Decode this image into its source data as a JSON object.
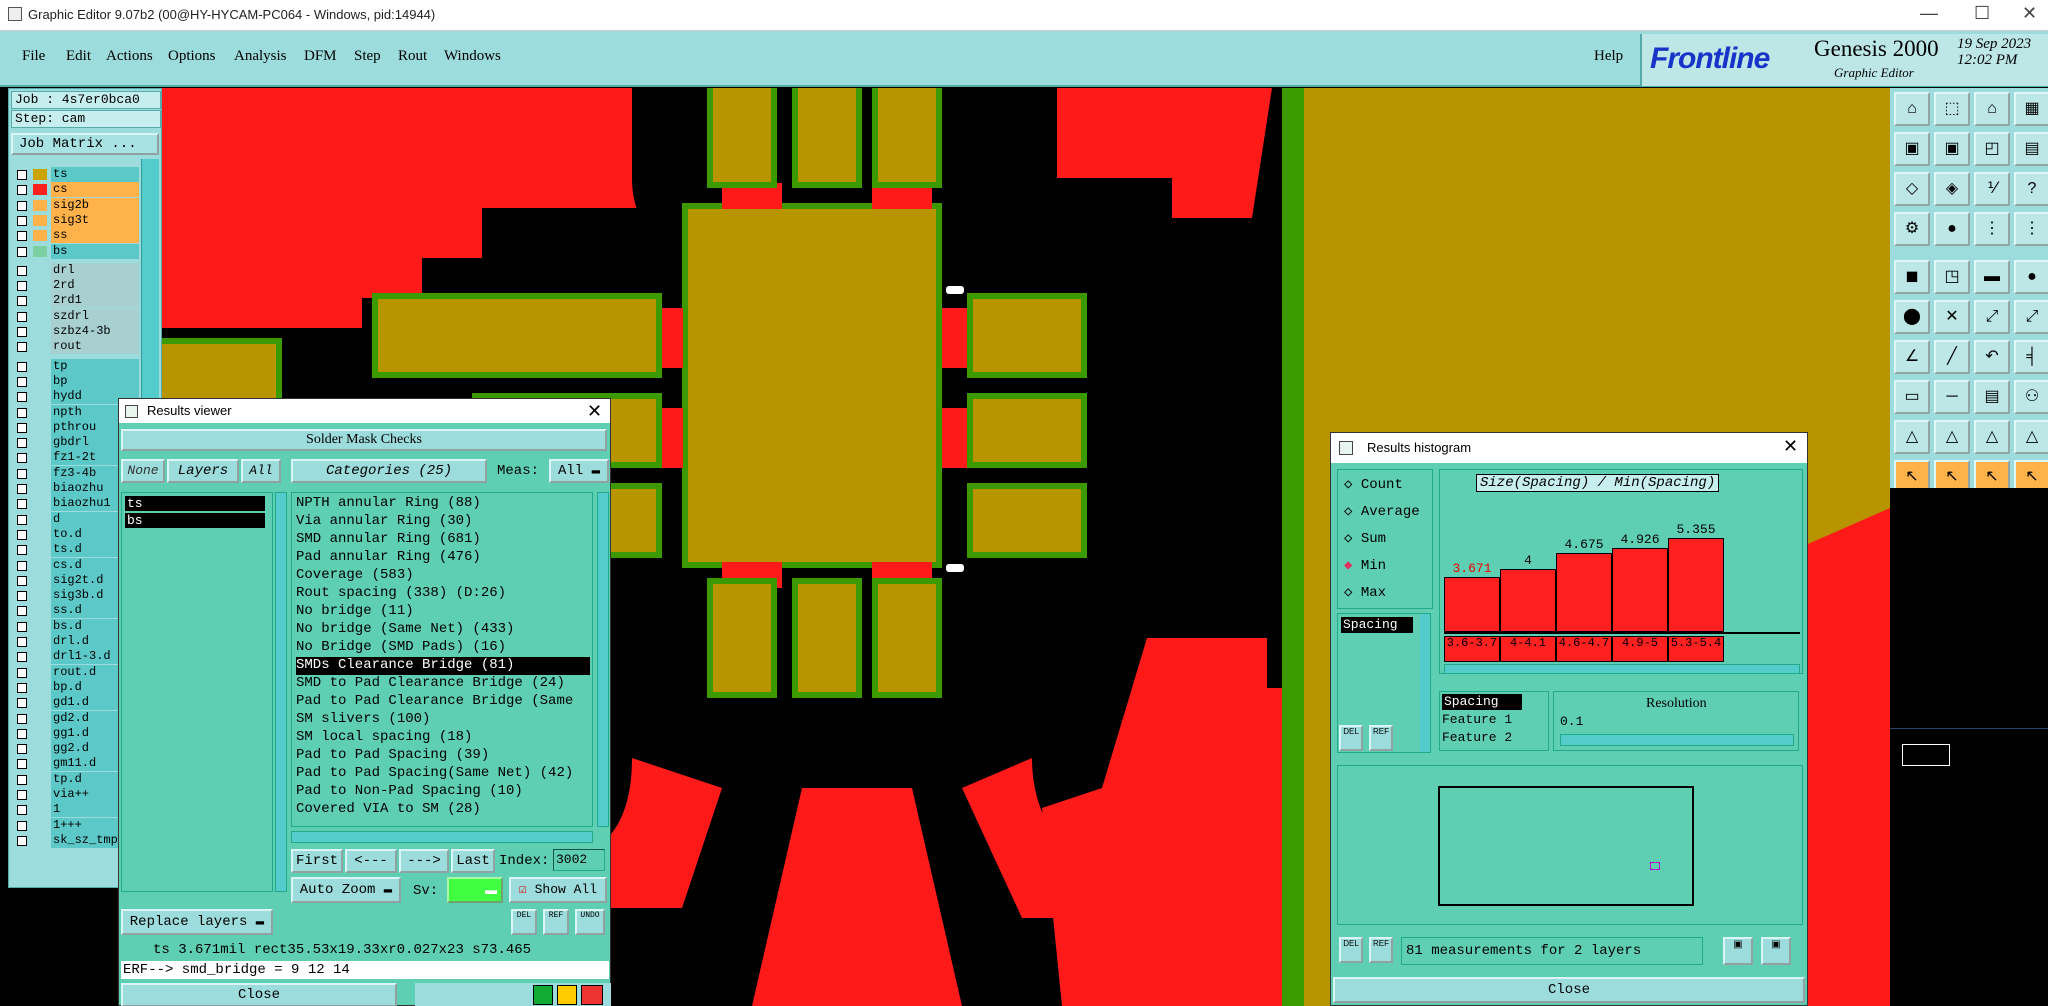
{
  "window": {
    "title": "Graphic Editor 9.07b2 (00@HY-HYCAM-PC064 - Windows, pid:14944)",
    "minimize": "—",
    "maximize": "☐",
    "close": "✕"
  },
  "menu": {
    "items": [
      "File",
      "Edit",
      "Actions",
      "Options",
      "Analysis",
      "DFM",
      "Step",
      "Rout",
      "Windows"
    ],
    "help": "Help"
  },
  "brand": {
    "logo": "Frontline",
    "product": "Genesis 2000",
    "subtitle": "Graphic Editor",
    "date": "19 Sep 2023",
    "time": "12:02 PM"
  },
  "left": {
    "job": "Job : 4s7er0bca0",
    "step": "Step: cam",
    "job_matrix": "Job Matrix ...",
    "layers_top": [
      {
        "name": "ts",
        "color": "#c9a400"
      },
      {
        "name": "cs",
        "color": "#ff2020"
      },
      {
        "name": "sig2b",
        "color": "#ffb24a"
      },
      {
        "name": "sig3t",
        "color": "#ffb24a"
      },
      {
        "name": "ss",
        "color": "#ffb24a"
      },
      {
        "name": "bs",
        "color": "#7ad0a0"
      }
    ],
    "layers_drill": [
      "drl",
      "2rd",
      "2rd1",
      "szdrl",
      "szbz4-3b",
      "rout"
    ],
    "layers_other": [
      "tp",
      "bp",
      "hydd",
      "npth",
      "pthrou",
      "gbdrl",
      "fz1-2t",
      "fz3-4b",
      "biaozhu",
      "biaozhu1",
      "d",
      "to.d",
      "ts.d",
      "cs.d",
      "sig2t.d",
      "sig3b.d",
      "ss.d",
      "bs.d",
      "drl.d",
      "drl1-3.d",
      "rout.d",
      "bp.d",
      "gd1.d",
      "gd2.d",
      "gg1.d",
      "gg2.d",
      "gm11.d",
      "tp.d",
      "via++",
      "1",
      "1+++",
      "sk_sz_tmp"
    ]
  },
  "results_viewer": {
    "title": "Results viewer",
    "heading": "Solder Mask Checks",
    "none_btn": "None",
    "layers_btn": "Layers",
    "all_btn": "All",
    "categories_label": "Categories (25)",
    "meas_label": "Meas:",
    "meas_value": "All",
    "layers": [
      "ts",
      "bs"
    ],
    "categories": [
      "NPTH annular Ring (88)",
      "Via annular Ring (30)",
      "SMD annular Ring (681)",
      "Pad annular Ring (476)",
      "Coverage (583)",
      "Rout spacing (338)         (D:26)",
      "No bridge (11)",
      "No bridge (Same Net) (433)",
      "No Bridge (SMD Pads) (16)",
      "SMDs Clearance Bridge (81)",
      "SMD to Pad Clearance Bridge (24)",
      "Pad to Pad Clearance Bridge (Same",
      "SM slivers (100)",
      "SM local spacing (18)",
      "Pad to Pad Spacing (39)",
      "Pad to Pad Spacing(Same Net) (42)",
      "Pad to Non-Pad Spacing (10)",
      "Covered VIA to SM (28)"
    ],
    "selected_index": 9,
    "nav": {
      "first": "First",
      "prev": "<---",
      "next": "--->",
      "last": "Last",
      "index_label": "Index:",
      "index_value": "3002"
    },
    "auto_zoom": "Auto Zoom",
    "sv_label": "Sv:",
    "show_all": "Show All",
    "replace_layers": "Replace layers",
    "status": "ts 3.671mil  rect35.53x19.33xr0.027x23  s73.465",
    "erf": "ERF--> smd_bridge = 9 12 14",
    "close": "Close",
    "del": "DEL",
    "ref": "REF",
    "undo": "UNDO"
  },
  "histogram": {
    "title": "Results histogram",
    "options": [
      "Count",
      "Average",
      "Sum",
      "Min",
      "Max"
    ],
    "selected": "Min",
    "chart_title": "Size(Spacing) / Min(Spacing)",
    "bars": [
      {
        "value": "3.671",
        "range": "3.6-3.7",
        "v": 3.671
      },
      {
        "value": "4",
        "range": "4-4.1",
        "v": 4.0
      },
      {
        "value": "4.675",
        "range": "4.6-4.7",
        "v": 4.675
      },
      {
        "value": "4.926",
        "range": "4.9-5",
        "v": 4.926
      },
      {
        "value": "5.355",
        "range": "5.3-5.4",
        "v": 5.355
      }
    ],
    "list_item": "Spacing",
    "measure_items": [
      "Spacing",
      "Feature 1",
      "Feature 2"
    ],
    "resolution_label": "Resolution",
    "resolution_value": "0.1",
    "footer": "81 measurements for 2 layers",
    "close": "Close"
  }
}
